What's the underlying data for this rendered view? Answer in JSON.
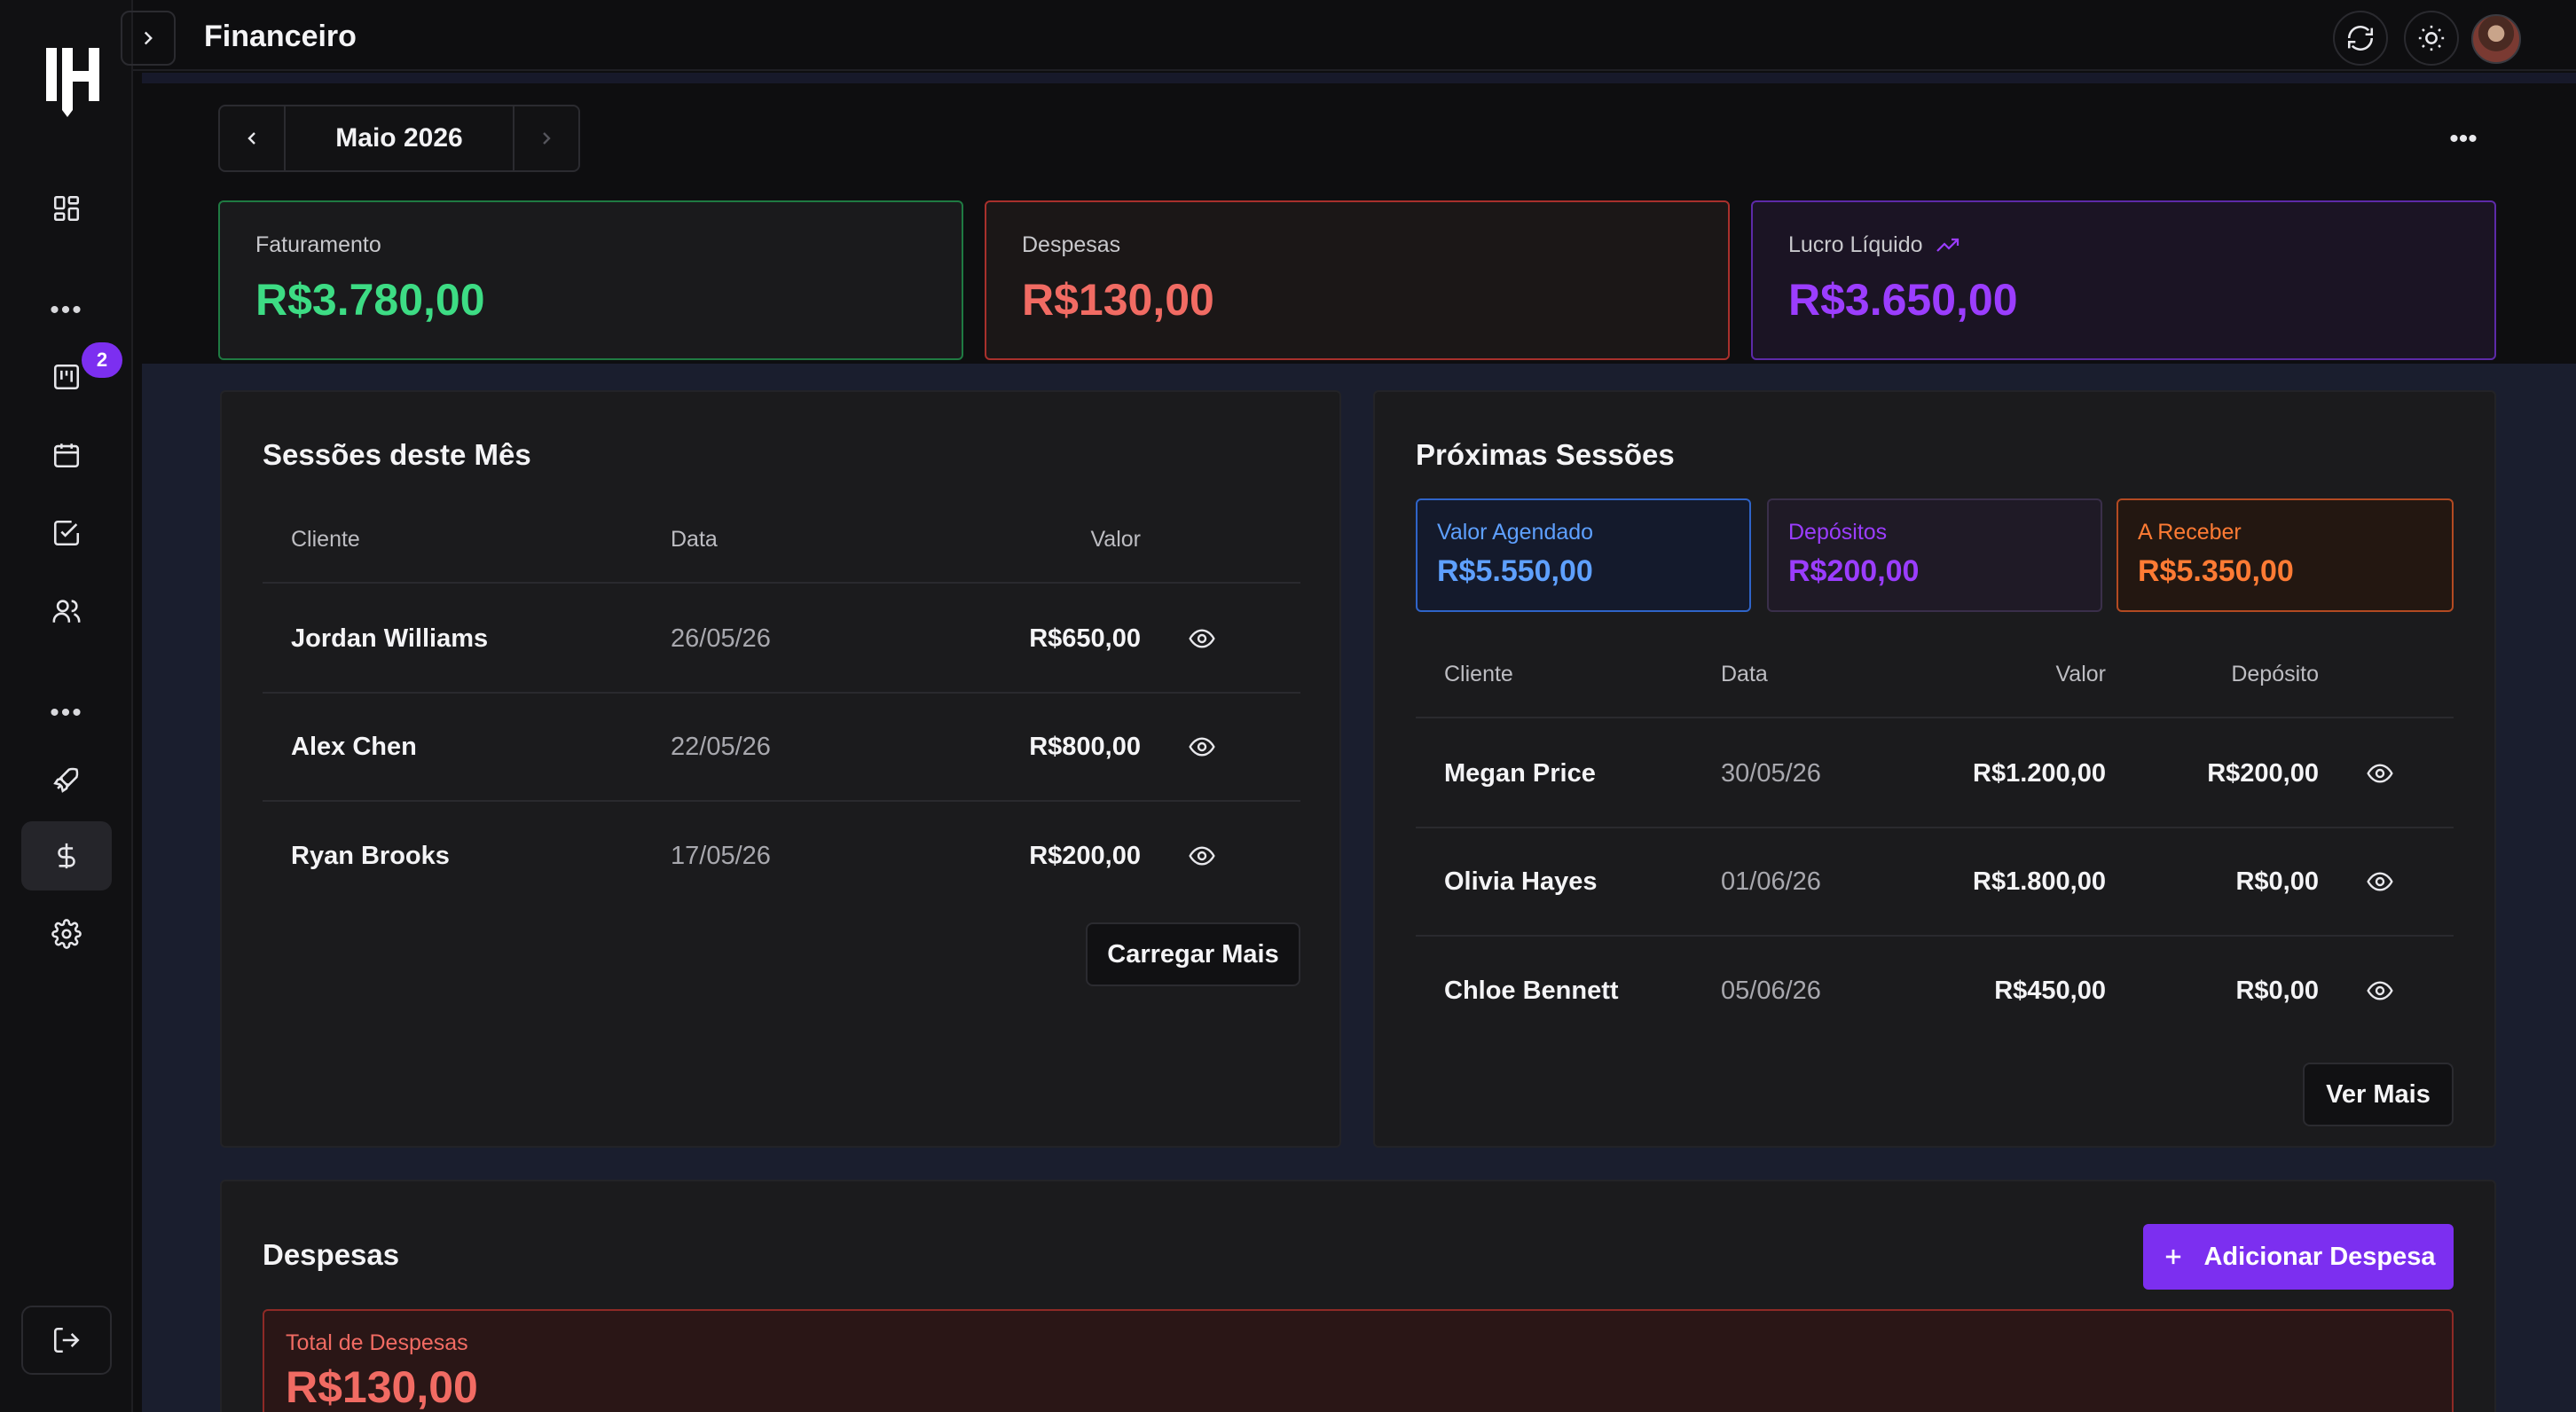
{
  "topbar": {
    "title": "Financeiro"
  },
  "sidebar": {
    "badge_count": "2"
  },
  "month_picker": {
    "label": "Maio 2026"
  },
  "kpis": [
    {
      "label": "Faturamento",
      "value": "R$3.780,00",
      "color": "#3ddc84"
    },
    {
      "label": "Despesas",
      "value": "R$130,00",
      "color": "#f16b63"
    },
    {
      "label": "Lucro Líquido",
      "value": "R$3.650,00",
      "color": "#9b3dff"
    }
  ],
  "sessions_month": {
    "title": "Sessões deste Mês",
    "headers": {
      "client": "Cliente",
      "date": "Data",
      "value": "Valor"
    },
    "rows": [
      {
        "client": "Jordan Williams",
        "date": "26/05/26",
        "value": "R$650,00"
      },
      {
        "client": "Alex Chen",
        "date": "22/05/26",
        "value": "R$800,00"
      },
      {
        "client": "Ryan Brooks",
        "date": "17/05/26",
        "value": "R$200,00"
      }
    ],
    "load_more": "Carregar Mais"
  },
  "upcoming": {
    "title": "Próximas Sessões",
    "summary": [
      {
        "label": "Valor Agendado",
        "value": "R$5.550,00",
        "color": "#5ea0ff"
      },
      {
        "label": "Depósitos",
        "value": "R$200,00",
        "color": "#9b3dff"
      },
      {
        "label": "A Receber",
        "value": "R$5.350,00",
        "color": "#ff7b34"
      }
    ],
    "headers": {
      "client": "Cliente",
      "date": "Data",
      "value": "Valor",
      "deposit": "Depósito"
    },
    "rows": [
      {
        "client": "Megan Price",
        "date": "30/05/26",
        "value": "R$1.200,00",
        "deposit": "R$200,00"
      },
      {
        "client": "Olivia Hayes",
        "date": "01/06/26",
        "value": "R$1.800,00",
        "deposit": "R$0,00"
      },
      {
        "client": "Chloe Bennett",
        "date": "05/06/26",
        "value": "R$450,00",
        "deposit": "R$0,00"
      }
    ],
    "see_more": "Ver Mais"
  },
  "expenses": {
    "title": "Despesas",
    "add_button": "Adicionar Despesa",
    "total_label": "Total de Despesas",
    "total_value": "R$130,00"
  },
  "icons": {
    "logo": "logo-icon",
    "nav": [
      "dashboard-icon",
      "kanban-icon",
      "calendar-icon",
      "check-square-icon",
      "users-icon",
      "rocket-icon",
      "dollar-icon",
      "gear-icon"
    ],
    "top": [
      "refresh-icon",
      "sun-icon"
    ],
    "eye": "eye-icon"
  },
  "colors": {
    "accent": "#7c2ff0"
  }
}
